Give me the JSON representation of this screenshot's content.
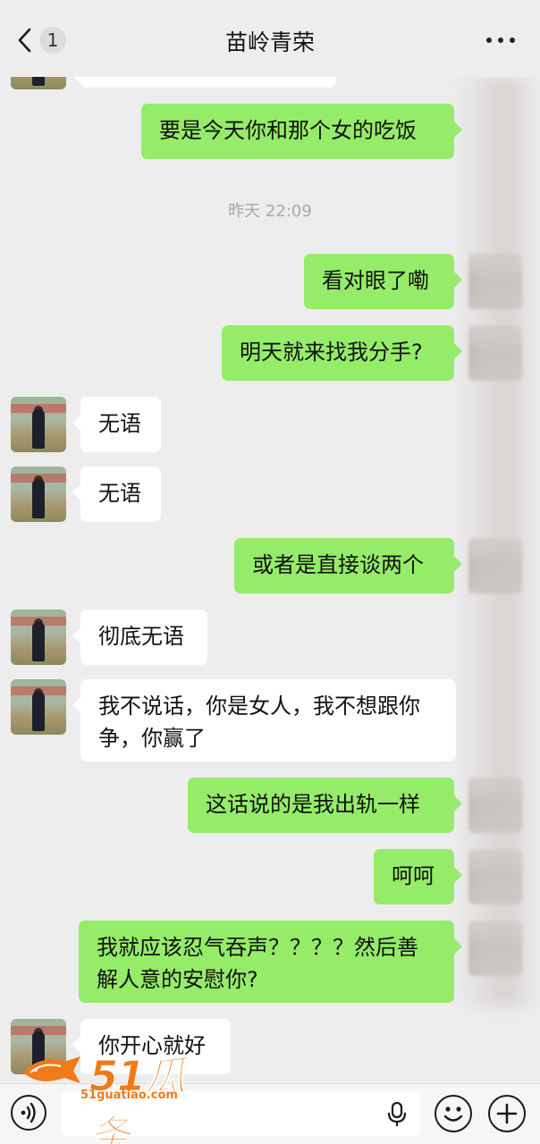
{
  "header": {
    "back_badge": "1",
    "title": "苗岭青荣"
  },
  "timestamp": "昨天 22:09",
  "messages": [
    {
      "from": "me",
      "text": "要是今天你和那个女的吃饭"
    },
    {
      "from": "me",
      "text": "看对眼了嘞"
    },
    {
      "from": "me",
      "text": "明天就来找我分手?"
    },
    {
      "from": "them",
      "text": "无语"
    },
    {
      "from": "them",
      "text": "无语"
    },
    {
      "from": "me",
      "text": "或者是直接谈两个"
    },
    {
      "from": "them",
      "text": "彻底无语"
    },
    {
      "from": "them",
      "text": "我不说话，你是女人，我不想跟你争，你赢了"
    },
    {
      "from": "me",
      "text": "这话说的是我出轨一样"
    },
    {
      "from": "me",
      "text": "呵呵"
    },
    {
      "from": "me",
      "text": "我就应该忍气吞声？？？？然后善解人意的安慰你?"
    },
    {
      "from": "them",
      "text": "你开心就好"
    }
  ],
  "watermark": {
    "brand": "51瓜条",
    "url": "51guatiao.com"
  },
  "icons": {
    "back": "chevron-left-icon",
    "more": "more-dots-icon",
    "voice": "voice-icon",
    "mic": "mic-icon",
    "emoji": "emoji-icon",
    "plus": "plus-icon"
  },
  "colors": {
    "background": "#ededed",
    "outgoing_bubble": "#95ec69",
    "incoming_bubble": "#ffffff",
    "brand_orange": "#f07a1a"
  }
}
